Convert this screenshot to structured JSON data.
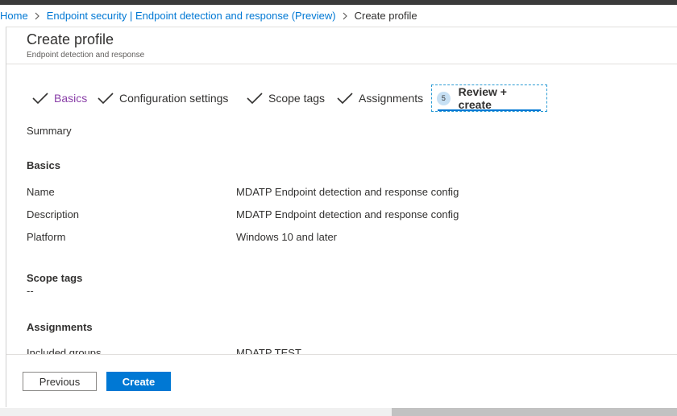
{
  "breadcrumb": {
    "home": "Home",
    "endpoint": "Endpoint security | Endpoint detection and response (Preview)",
    "current": "Create profile"
  },
  "header": {
    "title": "Create profile",
    "subtitle": "Endpoint detection and response"
  },
  "steps": [
    {
      "label": "Basics",
      "status": "completed"
    },
    {
      "label": "Configuration settings",
      "status": "completed"
    },
    {
      "label": "Scope tags",
      "status": "completed"
    },
    {
      "label": "Assignments",
      "status": "completed"
    },
    {
      "label": "Review + create",
      "number": "5",
      "status": "active"
    }
  ],
  "summary": {
    "heading": "Summary",
    "basics_heading": "Basics",
    "rows": [
      {
        "label": "Name",
        "value": "MDATP Endpoint detection and response config"
      },
      {
        "label": "Description",
        "value": "MDATP Endpoint detection and response config"
      },
      {
        "label": "Platform",
        "value": "Windows 10 and later"
      }
    ],
    "scope_tags_heading": "Scope tags",
    "scope_tags_value": "--",
    "assignments_heading": "Assignments",
    "assignments_rows": [
      {
        "label": "Included groups",
        "value": "MDATP TEST"
      }
    ]
  },
  "footer": {
    "previous_label": "Previous",
    "create_label": "Create"
  },
  "colors": {
    "accent": "#0078d4",
    "completed_step_text": "#8a3fa8",
    "active_step_border": "#2a9bd4"
  }
}
